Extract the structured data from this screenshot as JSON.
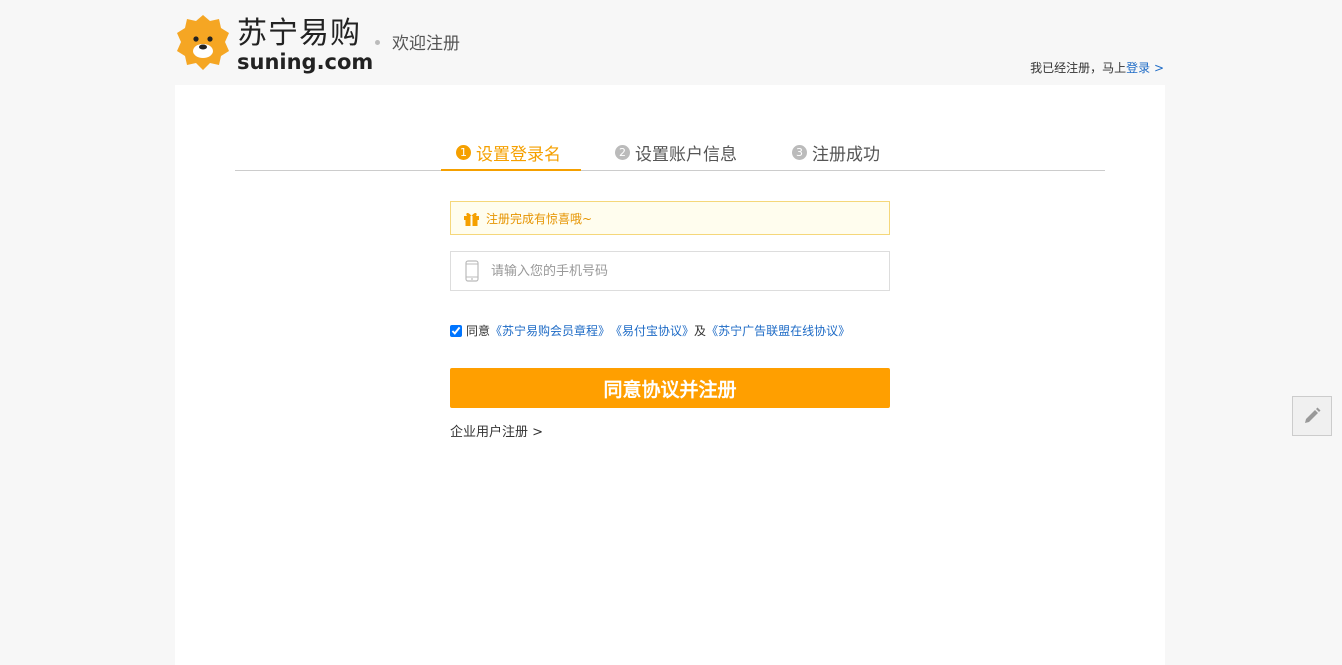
{
  "header": {
    "brand_cn": "苏宁易购",
    "brand_en": "suning.com",
    "welcome": "欢迎注册",
    "login_prefix": "我已经注册，马上",
    "login_link": "登录 >"
  },
  "steps": [
    {
      "num": "1",
      "label": "设置登录名",
      "active": true
    },
    {
      "num": "2",
      "label": "设置账户信息",
      "active": false
    },
    {
      "num": "3",
      "label": "注册成功",
      "active": false
    }
  ],
  "notice": {
    "text": "注册完成有惊喜哦~",
    "icon": "gift-icon"
  },
  "phone": {
    "placeholder": "请输入您的手机号码",
    "value": "",
    "icon": "phone-icon"
  },
  "agreement": {
    "checked": true,
    "prefix": "同意",
    "link1": "《苏宁易购会员章程》",
    "link2": "《易付宝协议》",
    "conj": "及",
    "link3": "《苏宁广告联盟在线协议》"
  },
  "submit_label": "同意协议并注册",
  "enterprise_link": "企业用户注册 >",
  "float_button": {
    "icon": "pencil-icon"
  },
  "colors": {
    "accent": "#ff9f00",
    "link": "#1e6bc6",
    "notice_bg": "#fffdee"
  }
}
